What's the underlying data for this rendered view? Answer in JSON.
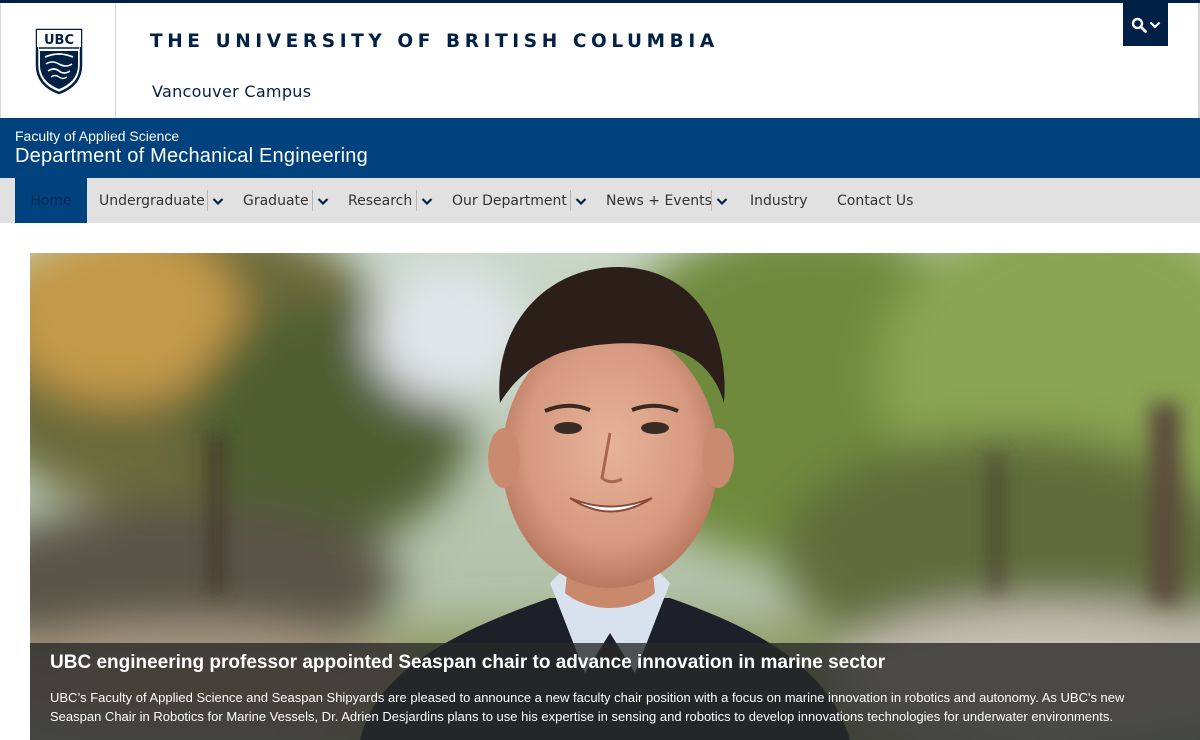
{
  "header": {
    "wordmark": "THE UNIVERSITY OF BRITISH COLUMBIA",
    "campus": "Vancouver Campus",
    "crest_text": "UBC",
    "search_icon": "search-icon",
    "brand_color": "#002145"
  },
  "unit": {
    "faculty": "Faculty of Applied Science",
    "department": "Department of Mechanical Engineering",
    "color": "#00427d"
  },
  "nav": {
    "home": "Home",
    "undergraduate": "Undergraduate",
    "graduate": "Graduate",
    "research": "Research",
    "our_department": "Our Department",
    "news_events": "News + Events",
    "industry": "Industry",
    "contact_us": "Contact Us"
  },
  "hero": {
    "title": "UBC engineering professor appointed Seaspan chair to advance innovation in marine sector",
    "body": "UBC’s Faculty of Applied Science and Seaspan Shipyards are pleased to announce a new faculty chair position with a focus on marine innovation in robotics and autonomy. As UBC's new Seaspan Chair in Robotics for Marine Vessels, Dr. Adrien Desjardins plans to use his expertise in sensing and robotics to develop innovations technologies for underwater environments."
  }
}
